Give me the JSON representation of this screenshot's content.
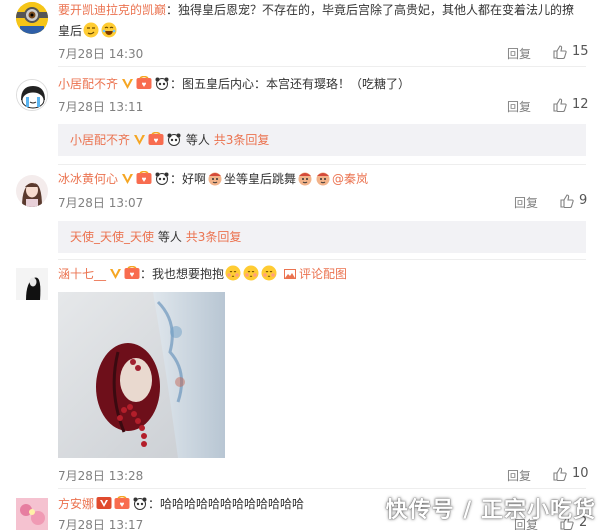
{
  "comments": [
    {
      "username": "要开凯迪拉克的凯巅",
      "text": "：独得皇后恩宠？不存在的，毕竟后宫除了高贵妃，其他人都在变着法儿的撩皇后",
      "time": "7月28日 14:30",
      "reply_label": "回复",
      "likes": "15",
      "avatar_icon": "minion-avatar"
    },
    {
      "username": "小居配不齐",
      "text": "：图五皇后内心：本宫还有璎珞！（吃糖了）",
      "time": "7月28日 13:11",
      "reply_label": "回复",
      "likes": "12",
      "avatar_icon": "crying-face-avatar",
      "sub": {
        "username": "小居配不齐",
        "text": "等人",
        "more": "共3条回复"
      }
    },
    {
      "username": "冰冰黄何心",
      "text": "：好啊",
      "text2": "坐等皇后跳舞",
      "mention": "@秦岚",
      "time": "7月28日 13:07",
      "reply_label": "回复",
      "likes": "9",
      "avatar_icon": "girl-photo-avatar",
      "sub": {
        "username": "天使_天使_天使",
        "text": "等人",
        "more": "共3条回复"
      }
    },
    {
      "username": "涵十七__",
      "text": "：我也想要抱抱",
      "image_link": "评论配图",
      "time": "7月28日 13:28",
      "reply_label": "回复",
      "likes": "10",
      "avatar_icon": "black-white-avatar"
    },
    {
      "username": "方安娜",
      "text": "：哈哈哈哈哈哈哈哈哈哈哈哈",
      "time": "7月28日 13:17",
      "reply_label": "回复",
      "likes": "2",
      "avatar_icon": "pink-flower-avatar"
    }
  ],
  "watermark": "快传号 / 正宗小吃货",
  "colors": {
    "username": "#eb7350",
    "meta": "#808080",
    "subbox_bg": "#f2f2f5"
  }
}
